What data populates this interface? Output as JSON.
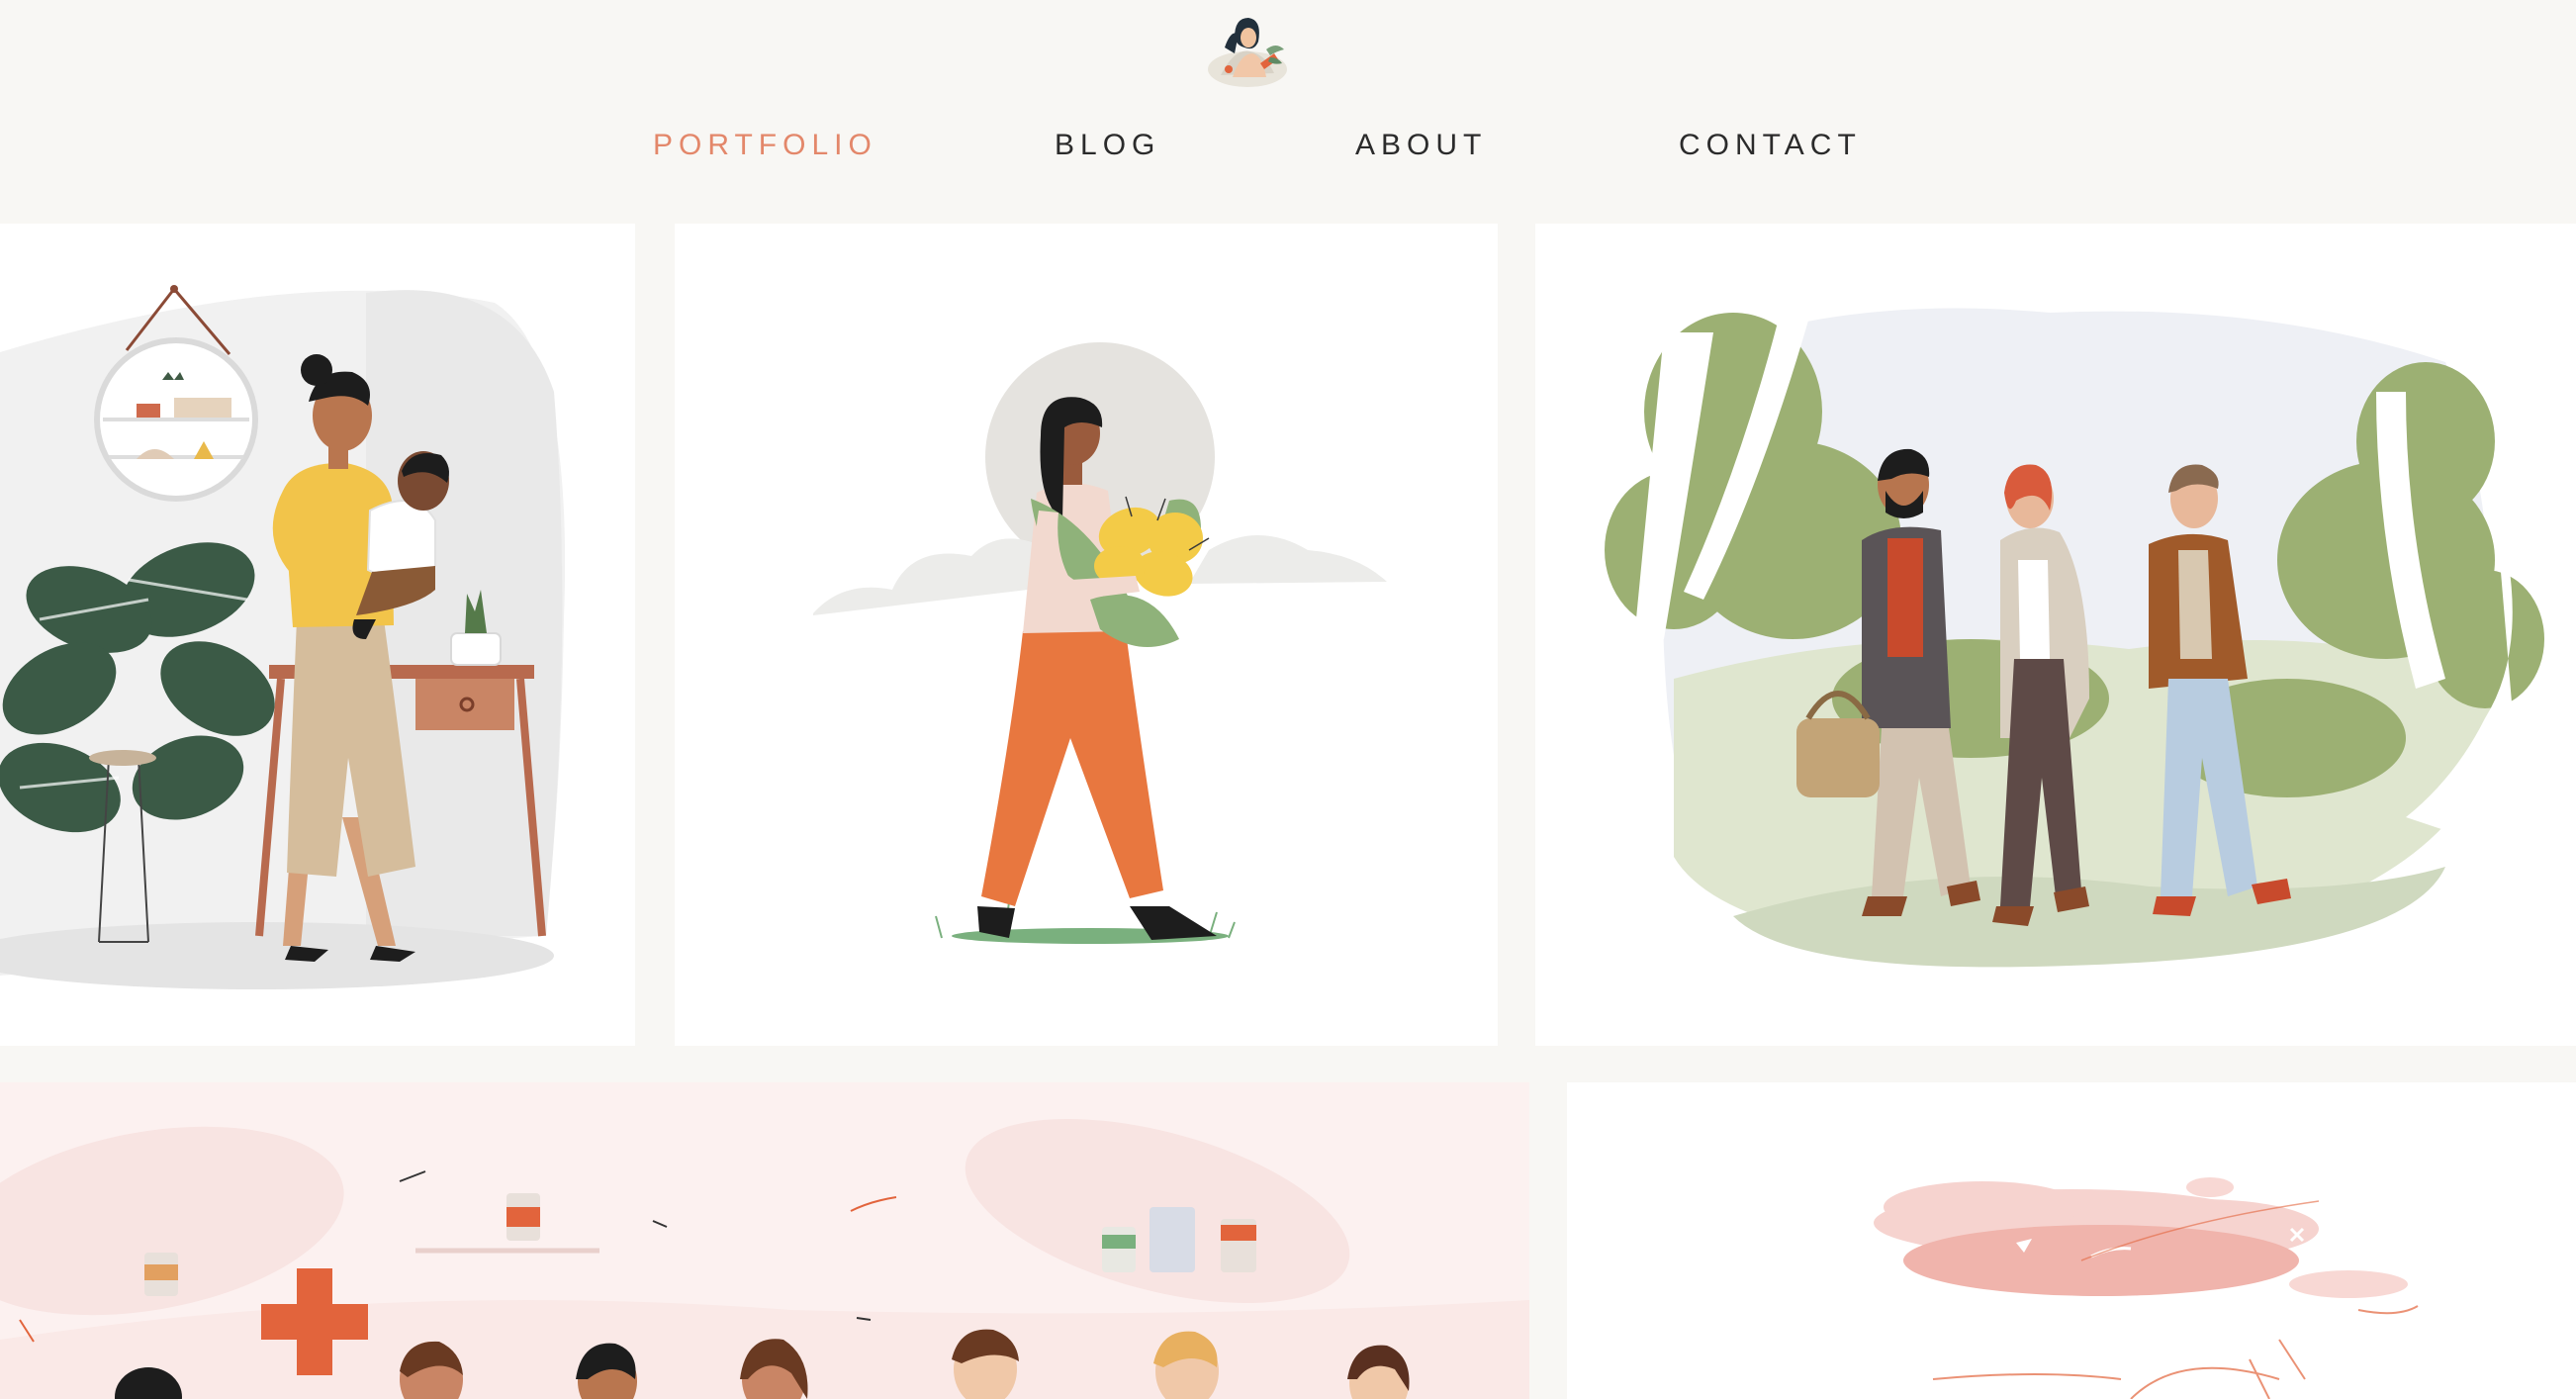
{
  "site": {
    "logo_icon": "illustrator-avatar-icon"
  },
  "nav": {
    "items": [
      {
        "label": "PORTFOLIO",
        "active": true
      },
      {
        "label": "BLOG",
        "active": false
      },
      {
        "label": "ABOUT",
        "active": false
      },
      {
        "label": "CONTACT",
        "active": false
      }
    ]
  },
  "colors": {
    "background": "#f8f7f4",
    "accent": "#e3876a",
    "nav_text": "#2b2b2b",
    "tile": "#ffffff",
    "pink_tile": "#fcf1f0"
  },
  "portfolio": {
    "tiles": [
      {
        "icon": "mother-with-baby-illustration"
      },
      {
        "icon": "woman-with-flowers-illustration"
      },
      {
        "icon": "three-friends-walking-illustration"
      },
      {
        "icon": "medical-team-illustration"
      },
      {
        "icon": "pink-clouds-illustration"
      }
    ]
  }
}
